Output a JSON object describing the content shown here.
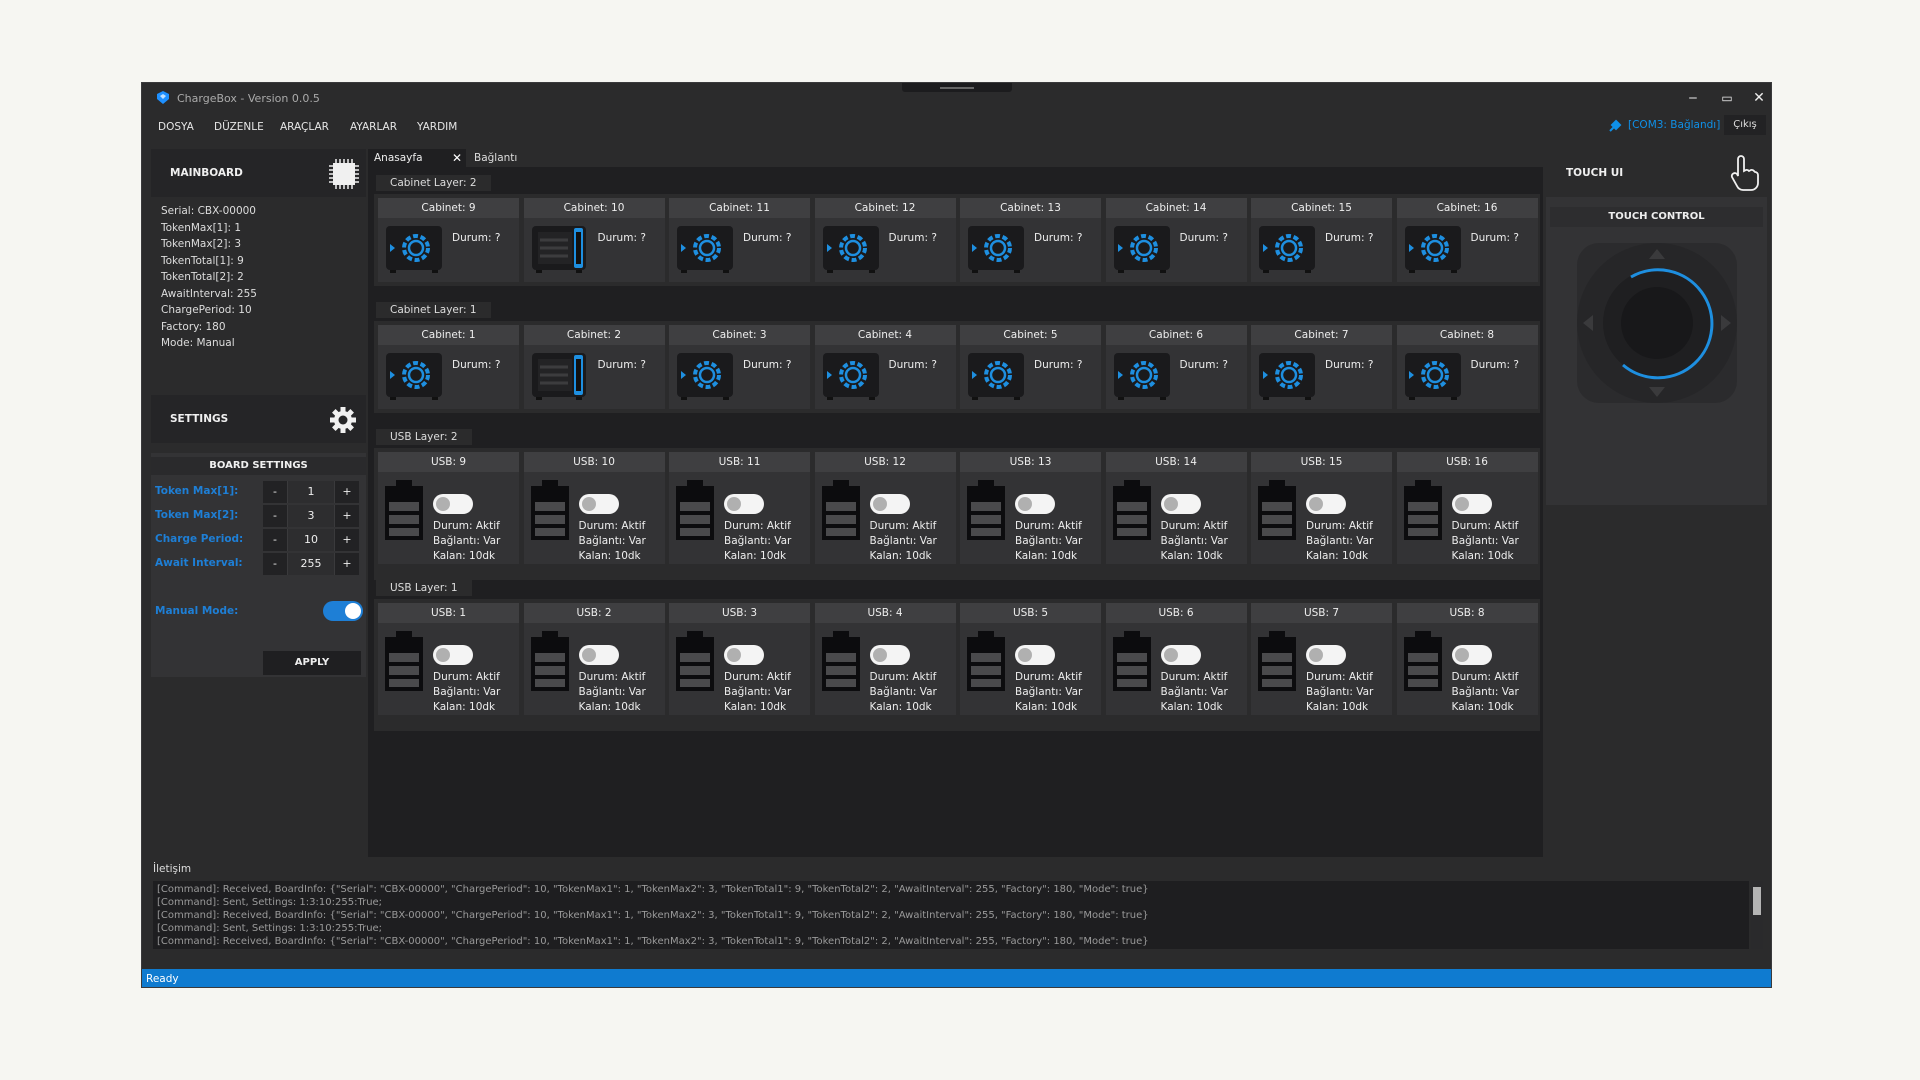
{
  "window": {
    "title": "ChargeBox - Version 0.0.5",
    "controls": {
      "minimize": "‒",
      "maximize": "▭",
      "close": "✕"
    }
  },
  "menu": [
    "DOSYA",
    "DÜZENLE",
    "ARAÇLAR",
    "AYARLAR",
    "YARDIM"
  ],
  "connection": {
    "status": "[COM3: Bağlandı]",
    "logout_label": "Çıkış"
  },
  "mainboard": {
    "title": "MAINBOARD",
    "info": [
      "Serial: CBX-00000",
      "TokenMax[1]: 1",
      "TokenMax[2]: 3",
      "TokenTotal[1]: 9",
      "TokenTotal[2]: 2",
      "AwaitInterval: 255",
      "ChargePeriod: 10",
      "Factory: 180",
      "Mode: Manual"
    ]
  },
  "settings": {
    "title": "SETTINGS",
    "board_title": "BOARD SETTINGS",
    "fields": [
      {
        "label": "Token Max[1]:",
        "value": "1",
        "minus": "-",
        "plus": "+"
      },
      {
        "label": "Token Max[2]:",
        "value": "3",
        "minus": "-",
        "plus": "+"
      },
      {
        "label": "Charge Period:",
        "value": "10",
        "minus": "-",
        "plus": "+"
      },
      {
        "label": "Await Interval:",
        "value": "255",
        "minus": "-",
        "plus": "+"
      }
    ],
    "manual_mode_label": "Manual Mode:",
    "manual_mode_on": true,
    "apply_label": "APPLY"
  },
  "tabs": [
    {
      "label": "Anasayfa",
      "close": "✕"
    },
    {
      "label": "Bağlantı"
    }
  ],
  "cabinet_layers": [
    {
      "label": "Cabinet Layer: 2",
      "items": [
        {
          "name": "Cabinet: 9",
          "status": "Durum: ?",
          "open": false
        },
        {
          "name": "Cabinet: 10",
          "status": "Durum: ?",
          "open": true
        },
        {
          "name": "Cabinet: 11",
          "status": "Durum: ?",
          "open": false
        },
        {
          "name": "Cabinet: 12",
          "status": "Durum: ?",
          "open": false
        },
        {
          "name": "Cabinet: 13",
          "status": "Durum: ?",
          "open": false
        },
        {
          "name": "Cabinet: 14",
          "status": "Durum: ?",
          "open": false
        },
        {
          "name": "Cabinet: 15",
          "status": "Durum: ?",
          "open": false
        },
        {
          "name": "Cabinet: 16",
          "status": "Durum: ?",
          "open": false
        }
      ]
    },
    {
      "label": "Cabinet Layer: 1",
      "items": [
        {
          "name": "Cabinet: 1",
          "status": "Durum: ?",
          "open": false
        },
        {
          "name": "Cabinet: 2",
          "status": "Durum: ?",
          "open": true
        },
        {
          "name": "Cabinet: 3",
          "status": "Durum: ?",
          "open": false
        },
        {
          "name": "Cabinet: 4",
          "status": "Durum: ?",
          "open": false
        },
        {
          "name": "Cabinet: 5",
          "status": "Durum: ?",
          "open": false
        },
        {
          "name": "Cabinet: 6",
          "status": "Durum: ?",
          "open": false
        },
        {
          "name": "Cabinet: 7",
          "status": "Durum: ?",
          "open": false
        },
        {
          "name": "Cabinet: 8",
          "status": "Durum: ?",
          "open": false
        }
      ]
    }
  ],
  "usb_layers": [
    {
      "label": "USB Layer: 2",
      "items": [
        {
          "name": "USB: 9",
          "status": "Durum: Aktif",
          "connection": "Bağlantı: Var",
          "remaining": "Kalan: 10dk"
        },
        {
          "name": "USB: 10",
          "status": "Durum: Aktif",
          "connection": "Bağlantı: Var",
          "remaining": "Kalan: 10dk"
        },
        {
          "name": "USB: 11",
          "status": "Durum: Aktif",
          "connection": "Bağlantı: Var",
          "remaining": "Kalan: 10dk"
        },
        {
          "name": "USB: 12",
          "status": "Durum: Aktif",
          "connection": "Bağlantı: Var",
          "remaining": "Kalan: 10dk"
        },
        {
          "name": "USB: 13",
          "status": "Durum: Aktif",
          "connection": "Bağlantı: Var",
          "remaining": "Kalan: 10dk"
        },
        {
          "name": "USB: 14",
          "status": "Durum: Aktif",
          "connection": "Bağlantı: Var",
          "remaining": "Kalan: 10dk"
        },
        {
          "name": "USB: 15",
          "status": "Durum: Aktif",
          "connection": "Bağlantı: Var",
          "remaining": "Kalan: 10dk"
        },
        {
          "name": "USB: 16",
          "status": "Durum: Aktif",
          "connection": "Bağlantı: Var",
          "remaining": "Kalan: 10dk"
        }
      ]
    },
    {
      "label": "USB Layer: 1",
      "items": [
        {
          "name": "USB: 1",
          "status": "Durum: Aktif",
          "connection": "Bağlantı: Var",
          "remaining": "Kalan: 10dk"
        },
        {
          "name": "USB: 2",
          "status": "Durum: Aktif",
          "connection": "Bağlantı: Var",
          "remaining": "Kalan: 10dk"
        },
        {
          "name": "USB: 3",
          "status": "Durum: Aktif",
          "connection": "Bağlantı: Var",
          "remaining": "Kalan: 10dk"
        },
        {
          "name": "USB: 4",
          "status": "Durum: Aktif",
          "connection": "Bağlantı: Var",
          "remaining": "Kalan: 10dk"
        },
        {
          "name": "USB: 5",
          "status": "Durum: Aktif",
          "connection": "Bağlantı: Var",
          "remaining": "Kalan: 10dk"
        },
        {
          "name": "USB: 6",
          "status": "Durum: Aktif",
          "connection": "Bağlantı: Var",
          "remaining": "Kalan: 10dk"
        },
        {
          "name": "USB: 7",
          "status": "Durum: Aktif",
          "connection": "Bağlantı: Var",
          "remaining": "Kalan: 10dk"
        },
        {
          "name": "USB: 8",
          "status": "Durum: Aktif",
          "connection": "Bağlantı: Var",
          "remaining": "Kalan: 10dk"
        }
      ]
    }
  ],
  "touch": {
    "title": "TOUCH UI",
    "control_title": "TOUCH CONTROL"
  },
  "log": {
    "tab": "İletişim",
    "lines": [
      "[Command]: Received, BoardInfo: {\"Serial\": \"CBX-00000\", \"ChargePeriod\": 10, \"TokenMax1\": 1, \"TokenMax2\": 3, \"TokenTotal1\": 9, \"TokenTotal2\": 2, \"AwaitInterval\": 255, \"Factory\": 180, \"Mode\": true}",
      "[Command]: Sent, Settings: 1:3:10:255:True;",
      "[Command]: Received, BoardInfo: {\"Serial\": \"CBX-00000\", \"ChargePeriod\": 10, \"TokenMax1\": 1, \"TokenMax2\": 3, \"TokenTotal1\": 9, \"TokenTotal2\": 2, \"AwaitInterval\": 255, \"Factory\": 180, \"Mode\": true}",
      "[Command]: Sent, Settings: 1:3:10:255:True;",
      "[Command]: Received, BoardInfo: {\"Serial\": \"CBX-00000\", \"ChargePeriod\": 10, \"TokenMax1\": 1, \"TokenMax2\": 3, \"TokenTotal1\": 9, \"TokenTotal2\": 2, \"AwaitInterval\": 255, \"Factory\": 180, \"Mode\": true}"
    ]
  },
  "status": "Ready",
  "colors": {
    "accent": "#1e7fd6",
    "statusbar": "#0f7bd0",
    "background": "#2b2b2c"
  }
}
